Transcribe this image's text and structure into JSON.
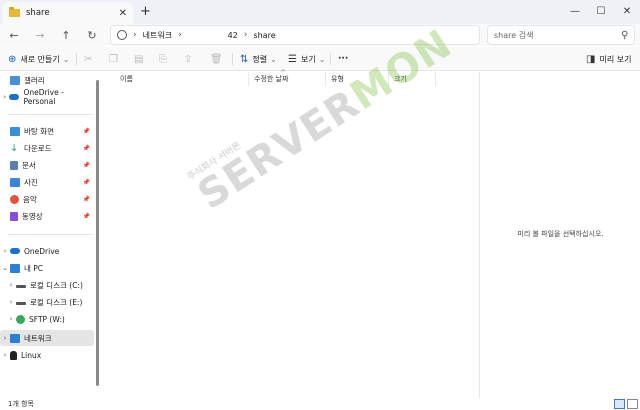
{
  "titlebar": {
    "tab_title": "share",
    "new_tab": "+",
    "minimize": "—",
    "maximize": "☐",
    "close": "✕"
  },
  "nav": {
    "back": "←",
    "forward": "→",
    "up": "↑",
    "refresh": "↻",
    "breadcrumb": [
      "네트워크",
      "42",
      "share"
    ],
    "search_placeholder": "share 검색"
  },
  "toolbar": {
    "new_label": "새로 만들기",
    "sort_label": "정렬",
    "view_label": "보기",
    "more_label": "···",
    "preview_label": "미리 보기"
  },
  "sidebar": {
    "items": [
      {
        "label": "갤러리",
        "icon": "gallery-icon",
        "color": "#4a90d9"
      },
      {
        "label": "OneDrive - Personal",
        "icon": "cloud-icon",
        "color": "#1f6fc5"
      },
      {
        "label": "바탕 화면",
        "icon": "desktop-icon",
        "color": "#3a8fd8"
      },
      {
        "label": "다운로드",
        "icon": "download-icon",
        "color": "#2aa17a"
      },
      {
        "label": "문서",
        "icon": "document-icon",
        "color": "#5a7fb0"
      },
      {
        "label": "사진",
        "icon": "pictures-icon",
        "color": "#3b86d6"
      },
      {
        "label": "음악",
        "icon": "music-icon",
        "color": "#e0533d"
      },
      {
        "label": "동영상",
        "icon": "video-icon",
        "color": "#8a4ed6"
      },
      {
        "label": "OneDrive",
        "icon": "cloud-icon",
        "color": "#1f6fc5"
      },
      {
        "label": "내 PC",
        "icon": "pc-icon",
        "color": "#2b7fd4"
      },
      {
        "label": "로컬 디스크 (C:)",
        "icon": "drive-icon",
        "color": "#555555"
      },
      {
        "label": "로컬 디스크 (E:)",
        "icon": "drive-icon",
        "color": "#555555"
      },
      {
        "label": "SFTP (W:)",
        "icon": "network-drive-icon",
        "color": "#3aa55c"
      },
      {
        "label": "네트워크",
        "icon": "network-icon",
        "color": "#2b7fd4"
      },
      {
        "label": "Linux",
        "icon": "linux-icon",
        "color": "#222222"
      }
    ]
  },
  "columns": [
    "이름",
    "수정한 날짜",
    "유형",
    "크기"
  ],
  "preview_message": "미리 볼 파일을 선택하십시오.",
  "status": {
    "count": "1개 항목"
  },
  "watermark": {
    "text1": "SERVER",
    "text2": "MON",
    "company": "주식회사 서버몬"
  }
}
